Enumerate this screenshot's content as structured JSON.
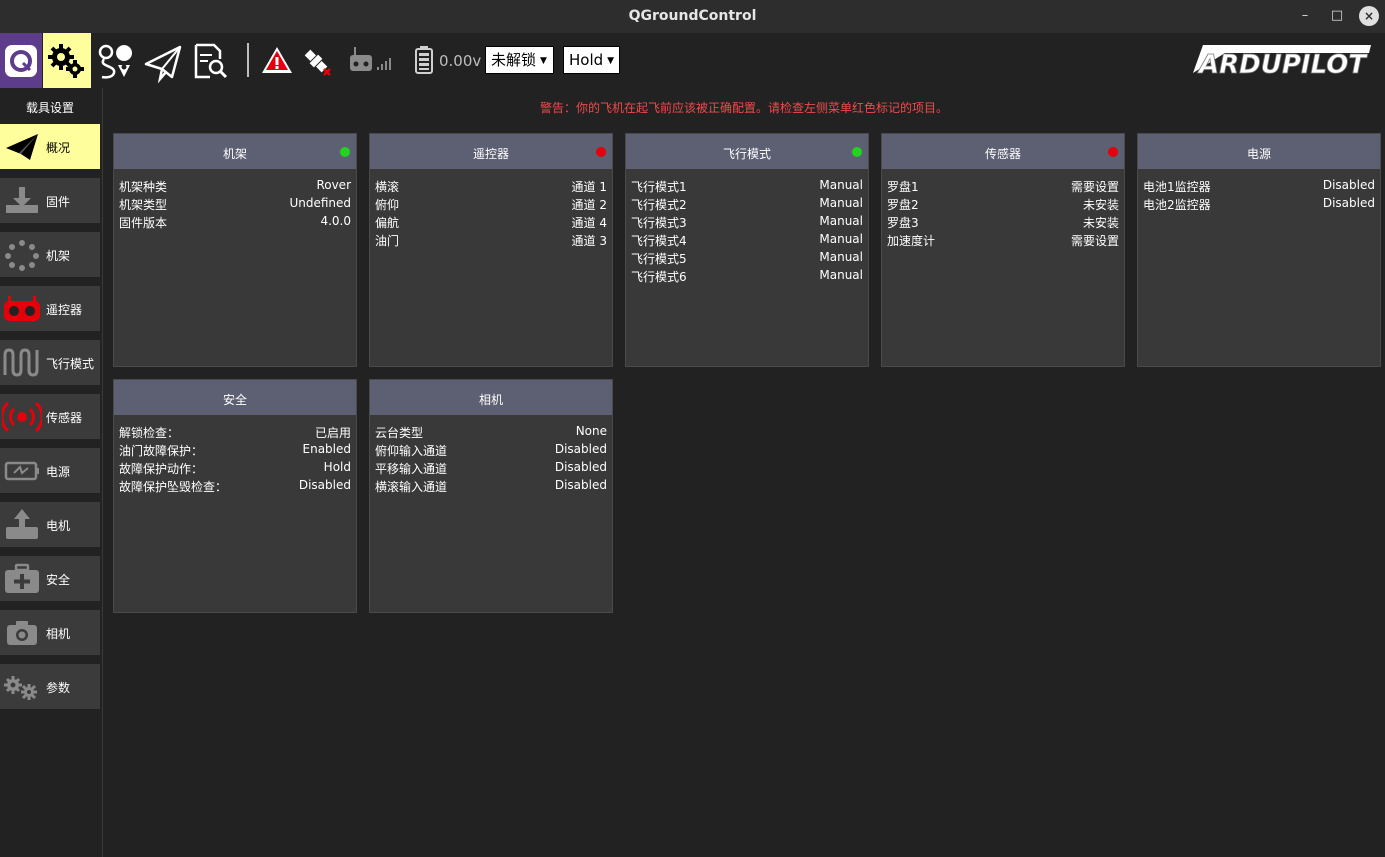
{
  "window": {
    "title": "QGroundControl",
    "minimize": "–",
    "maximize": "□",
    "close": "×"
  },
  "toolbar": {
    "battery_voltage": "0.00v",
    "arm_select": "未解锁",
    "mode_select": "Hold",
    "brand": "ARDUPILOT",
    "icons": [
      "qgc-logo-icon",
      "vehicle-setup-gear-icon",
      "plan-route-icon",
      "fly-paper-plane-icon",
      "analyze-document-icon",
      "warning-triangle-icon",
      "gps-satellite-icon",
      "rc-signal-icon",
      "battery-icon"
    ]
  },
  "sidebar": {
    "header": "载具设置",
    "items": [
      {
        "label": "概况",
        "icon": "paper-plane-icon",
        "active": true
      },
      {
        "label": "固件",
        "icon": "download-icon"
      },
      {
        "label": "机架",
        "icon": "airframe-dots-icon"
      },
      {
        "label": "遥控器",
        "icon": "radio-controller-icon"
      },
      {
        "label": "飞行模式",
        "icon": "flight-modes-wave-icon"
      },
      {
        "label": "传感器",
        "icon": "sensor-broadcast-icon"
      },
      {
        "label": "电源",
        "icon": "battery-power-icon"
      },
      {
        "label": "电机",
        "icon": "motor-up-icon"
      },
      {
        "label": "安全",
        "icon": "first-aid-kit-icon"
      },
      {
        "label": "相机",
        "icon": "camera-icon"
      },
      {
        "label": "参数",
        "icon": "parameters-gears-icon"
      }
    ]
  },
  "warning": "警告：你的飞机在起飞前应该被正确配置。请检查左侧菜单红色标记的项目。",
  "colors": {
    "ok": "#1fd51f",
    "error": "#e5000a",
    "active": "#fffe9c",
    "panel_header": "#5d5f72"
  },
  "panels": [
    {
      "title": "机架",
      "status": "ok",
      "rows": [
        {
          "k": "机架种类",
          "v": "Rover"
        },
        {
          "k": "机架类型",
          "v": "Undefined"
        },
        {
          "k": "固件版本",
          "v": "4.0.0"
        }
      ]
    },
    {
      "title": "遥控器",
      "status": "error",
      "rows": [
        {
          "k": "横滚",
          "v": "通道 1"
        },
        {
          "k": "俯仰",
          "v": "通道 2"
        },
        {
          "k": "偏航",
          "v": "通道 4"
        },
        {
          "k": "油门",
          "v": "通道 3"
        }
      ]
    },
    {
      "title": "飞行模式",
      "status": "ok",
      "rows": [
        {
          "k": "飞行模式1",
          "v": "Manual"
        },
        {
          "k": "飞行模式2",
          "v": "Manual"
        },
        {
          "k": "飞行模式3",
          "v": "Manual"
        },
        {
          "k": "飞行模式4",
          "v": "Manual"
        },
        {
          "k": "飞行模式5",
          "v": "Manual"
        },
        {
          "k": "飞行模式6",
          "v": "Manual"
        }
      ]
    },
    {
      "title": "传感器",
      "status": "error",
      "rows": [
        {
          "k": "罗盘1",
          "v": "需要设置"
        },
        {
          "k": "罗盘2",
          "v": "未安装"
        },
        {
          "k": "罗盘3",
          "v": "未安装"
        },
        {
          "k": "加速度计",
          "v": "需要设置"
        }
      ]
    },
    {
      "title": "电源",
      "status": "none",
      "rows": [
        {
          "k": "电池1监控器",
          "v": "Disabled"
        },
        {
          "k": "电池2监控器",
          "v": "Disabled"
        }
      ]
    },
    {
      "title": "安全",
      "status": "none",
      "rows": [
        {
          "k": "解锁检查：",
          "v": "已启用"
        },
        {
          "k": "油门故障保护：",
          "v": "Enabled"
        },
        {
          "k": "故障保护动作：",
          "v": "Hold"
        },
        {
          "k": "故障保护坠毁检查：",
          "v": "Disabled"
        }
      ]
    },
    {
      "title": "相机",
      "status": "none",
      "rows": [
        {
          "k": "云台类型",
          "v": "None"
        },
        {
          "k": "俯仰输入通道",
          "v": "Disabled"
        },
        {
          "k": "平移输入通道",
          "v": "Disabled"
        },
        {
          "k": "横滚输入通道",
          "v": "Disabled"
        }
      ]
    }
  ]
}
